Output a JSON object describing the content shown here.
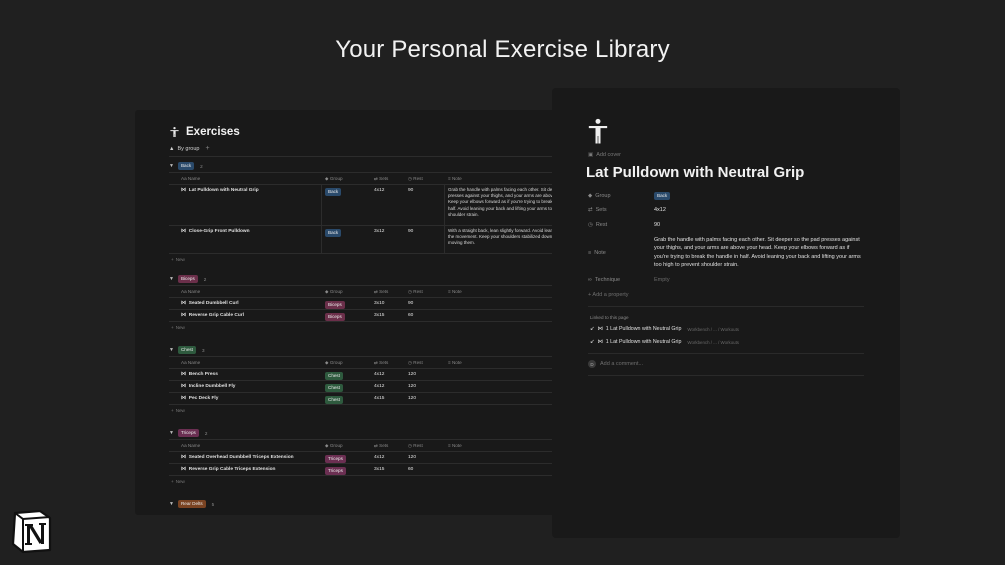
{
  "headline": "Your Personal Exercise Library",
  "database": {
    "title": "Exercises",
    "view_label": "By group",
    "view_add": "+",
    "columns": {
      "name": "Name",
      "group": "Group",
      "sets": "Sets",
      "rest": "Rest",
      "note": "Note"
    },
    "new_label": "New",
    "groups": [
      {
        "label": "Back",
        "count": "2",
        "rows": [
          {
            "name": "Lat Pulldown with Neutral Grip",
            "group": "Back",
            "sets": "4x12",
            "rest": "90",
            "note": "Grab the handle with palms facing each other. Sit deeper so the pad presses against your thighs, and your arms are above your head. Keep your elbows forward as if you're trying to break the handle in half. Avoid leaning your back and lifting your arms too high to prevent shoulder strain."
          },
          {
            "name": "Close-Grip Front Pulldown",
            "group": "Back",
            "sets": "3x12",
            "rest": "90",
            "note": "With a straight back, lean slightly forward. Avoid leaning back during the movement. Keep your shoulders stabilized down and avoid moving them."
          }
        ]
      },
      {
        "label": "Biceps",
        "count": "2",
        "rows": [
          {
            "name": "Seated Dumbbell Curl",
            "group": "Biceps",
            "sets": "3x10",
            "rest": "90",
            "note": ""
          },
          {
            "name": "Reverse Grip Cable Curl",
            "group": "Biceps",
            "sets": "3x15",
            "rest": "60",
            "note": ""
          }
        ]
      },
      {
        "label": "Chest",
        "count": "3",
        "rows": [
          {
            "name": "Bench Press",
            "group": "Chest",
            "sets": "4x12",
            "rest": "120",
            "note": ""
          },
          {
            "name": "Incline Dumbbell Fly",
            "group": "Chest",
            "sets": "4x12",
            "rest": "120",
            "note": ""
          },
          {
            "name": "Pec Deck Fly",
            "group": "Chest",
            "sets": "4x15",
            "rest": "120",
            "note": ""
          }
        ]
      },
      {
        "label": "Triceps",
        "count": "2",
        "rows": [
          {
            "name": "Seated Overhead Dumbbell Triceps Extension",
            "group": "Triceps",
            "sets": "4x12",
            "rest": "120",
            "note": ""
          },
          {
            "name": "Reverse Grip Cable Triceps Extension",
            "group": "Triceps",
            "sets": "3x15",
            "rest": "60",
            "note": ""
          }
        ]
      },
      {
        "label": "Rear Delts",
        "count": "5",
        "rows": []
      }
    ]
  },
  "page": {
    "add_cover": "Add cover",
    "title": "Lat Pulldown with Neutral Grip",
    "props": {
      "group_key": "Group",
      "group_val": "Back",
      "sets_key": "Sets",
      "sets_val": "4x12",
      "rest_key": "Rest",
      "rest_val": "90",
      "note_key": "Note",
      "note_val": "Grab the handle with palms facing each other. Sit deeper so the pad presses against your thighs, and your arms are above your head. Keep your elbows forward as if you're trying to break the handle in half. Avoid leaning your back and lifting your arms too high to prevent shoulder strain.",
      "technique_key": "Technique",
      "technique_val": "Empty"
    },
    "add_property": "+ Add a property",
    "linked_label": "Linked to this page",
    "linked": [
      {
        "title": "1 Lat Pulldown with Neutral Grip",
        "path": "Workbench / ... / Workouts"
      },
      {
        "title": "1 Lat Pulldown with Neutral Grip",
        "path": "Workbench / ... / Workouts"
      }
    ],
    "comment_placeholder": "Add a comment..."
  }
}
